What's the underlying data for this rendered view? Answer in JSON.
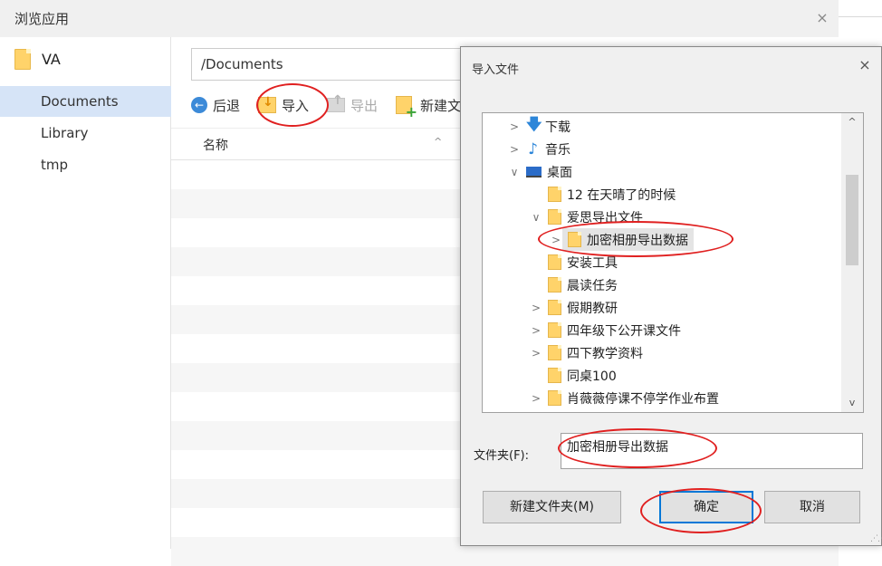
{
  "app": {
    "title": "浏览应用",
    "close_glyph": "×",
    "sidebar": {
      "root": "VA",
      "items": [
        "Documents",
        "Library",
        "tmp"
      ],
      "active_index": 0
    },
    "path": "/Documents",
    "toolbar": {
      "back": "后退",
      "import": "导入",
      "export": "导出",
      "new": "新建文"
    },
    "columns": {
      "name": "名称",
      "sort_glyph": "^"
    },
    "icons": {
      "back": "arrow-left-circle-icon",
      "import": "folder-import-icon",
      "export": "export-icon",
      "new": "new-folder-icon"
    }
  },
  "dialog": {
    "title": "导入文件",
    "close_glyph": "×",
    "tree": [
      {
        "label": "下载",
        "icon": "download-icon",
        "chevron": ">"
      },
      {
        "label": "音乐",
        "icon": "music-icon",
        "chevron": ">"
      },
      {
        "label": "桌面",
        "icon": "desktop-icon",
        "chevron": "∨"
      },
      {
        "label": "12 在天晴了的时候",
        "icon": "folder-icon",
        "chevron": ""
      },
      {
        "label": "爱思导出文件",
        "icon": "folder-icon",
        "chevron": "∨"
      },
      {
        "label": "加密相册导出数据",
        "icon": "folder-icon",
        "chevron": ">",
        "selected": true
      },
      {
        "label": "安装工具",
        "icon": "folder-icon",
        "chevron": ""
      },
      {
        "label": "晨读任务",
        "icon": "folder-icon",
        "chevron": ""
      },
      {
        "label": "假期教研",
        "icon": "folder-icon",
        "chevron": ">"
      },
      {
        "label": "四年级下公开课文件",
        "icon": "folder-icon",
        "chevron": ">"
      },
      {
        "label": "四下教学资料",
        "icon": "folder-icon",
        "chevron": ">"
      },
      {
        "label": "同桌100",
        "icon": "folder-icon",
        "chevron": ""
      },
      {
        "label": "肖薇薇停课不停学作业布置",
        "icon": "folder-icon",
        "chevron": ">"
      }
    ],
    "scroll": {
      "up": "^",
      "down": "v"
    },
    "folder_label": "文件夹(F):",
    "folder_value": "加密相册导出数据",
    "buttons": {
      "new_folder": "新建文件夹(M)",
      "ok": "确定",
      "cancel": "取消"
    }
  },
  "colors": {
    "annotation": "#e02020",
    "selection": "#d6e4f7",
    "accent": "#0078d7"
  }
}
